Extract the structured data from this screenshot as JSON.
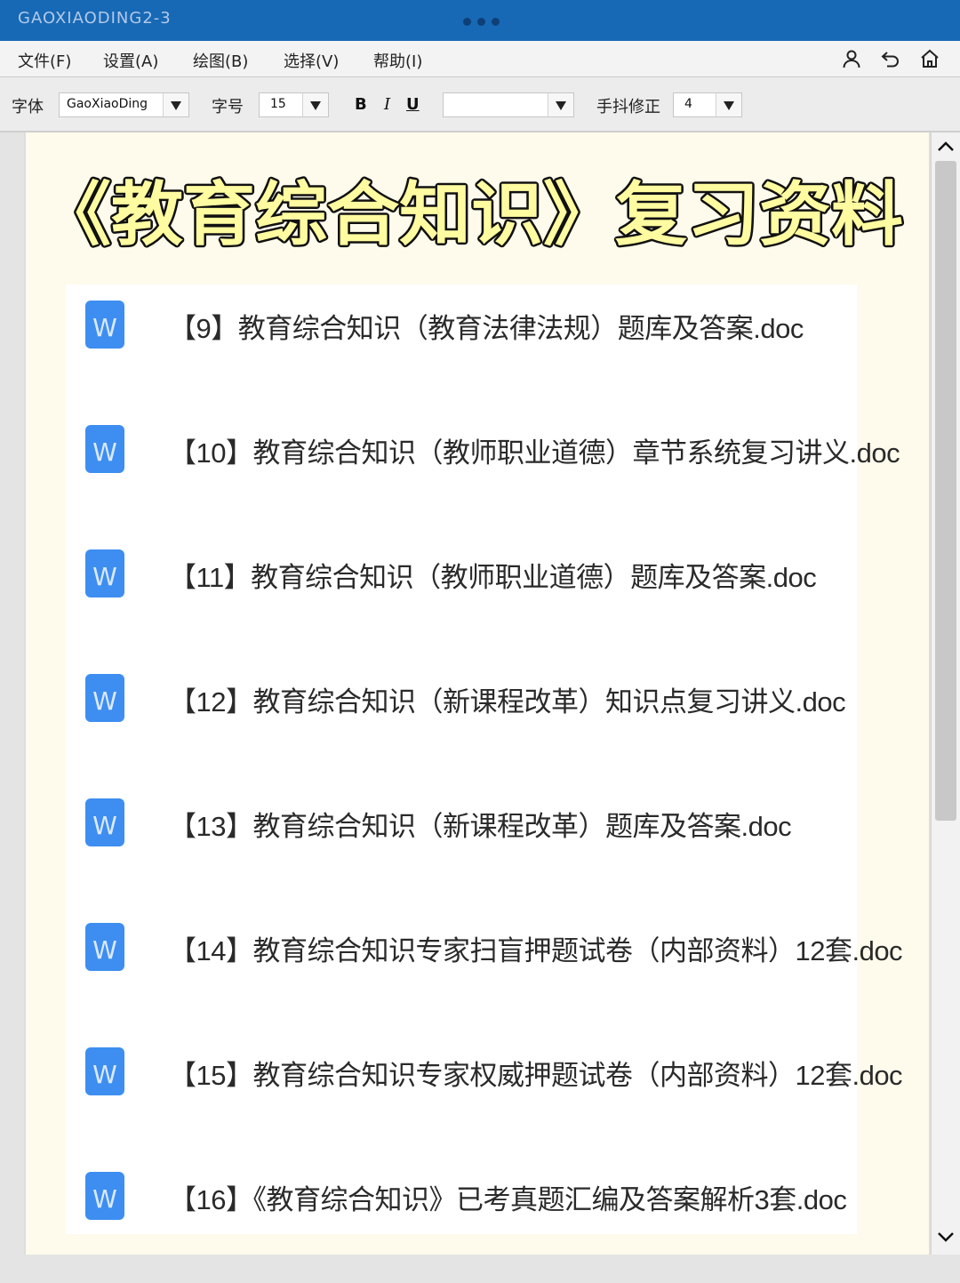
{
  "window": {
    "title": "GAOXIAODING2-3"
  },
  "menu": {
    "items": [
      "文件(F)",
      "设置(A)",
      "绘图(B)",
      "选择(V)",
      "帮助(I)"
    ]
  },
  "toolbar": {
    "font_label": "字体",
    "font_value": "GaoXiaoDing",
    "size_label": "字号",
    "size_value": "15",
    "bold": "B",
    "italic": "I",
    "underline": "U",
    "color_value": "",
    "jitter_label": "手抖修正",
    "jitter_value": "4"
  },
  "document": {
    "heading": "《教育综合知识》复习资料",
    "files": [
      "【9】教育综合知识（教育法律法规）题库及答案.doc",
      "【10】教育综合知识（教师职业道德）章节系统复习讲义.doc",
      "【11】教育综合知识（教师职业道德）题库及答案.doc",
      "【12】教育综合知识（新课程改革）知识点复习讲义.doc",
      "【13】教育综合知识（新课程改革）题库及答案.doc",
      "【14】教育综合知识专家扫盲押题试卷（内部资料）12套.doc",
      "【15】教育综合知识专家权威押题试卷（内部资料）12套.doc",
      "【16】《教育综合知识》已考真题汇编及答案解析3套.doc"
    ],
    "file_icon": "word-doc-icon",
    "file_icon_letter": "W"
  },
  "colors": {
    "titlebar": "#1769b5",
    "heading_fill": "#fffba0",
    "heading_stroke": "#111111",
    "word_blue": "#3d8ef0"
  }
}
